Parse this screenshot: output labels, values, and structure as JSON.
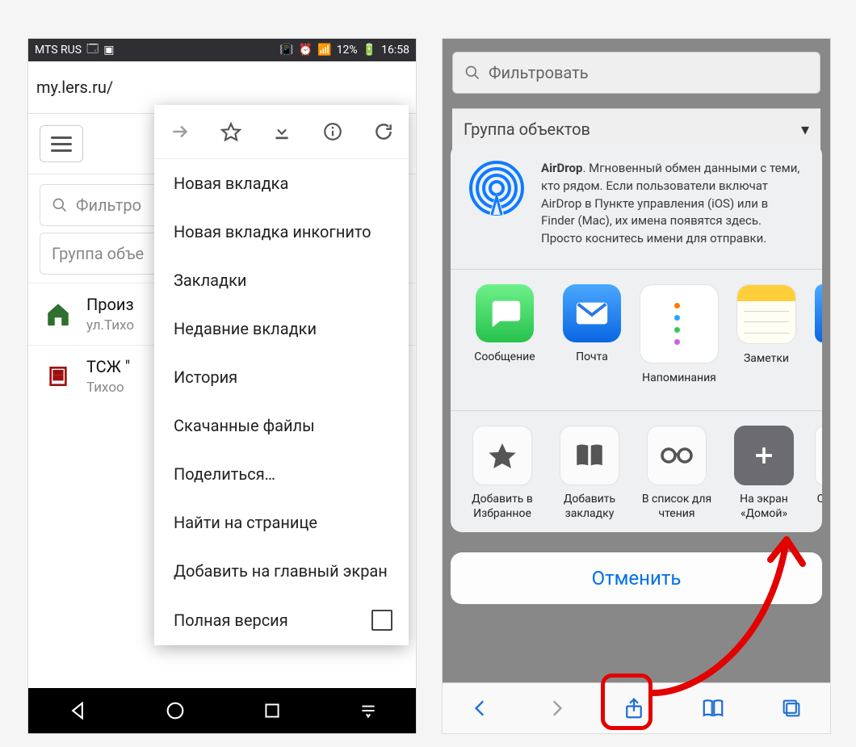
{
  "android": {
    "statusbar": {
      "carrier": "MTS RUS",
      "battery_pct": "12%",
      "clock": "16:58"
    },
    "url": "my.lers.ru/",
    "filter_placeholder": "Фильтро",
    "group_placeholder": "Группа объе",
    "items": [
      {
        "title": "Произ",
        "sub": "ул.Тихо"
      },
      {
        "title": "ТСЖ \"",
        "sub": "Тихоо"
      }
    ],
    "menu": {
      "entries": [
        "Новая вкладка",
        "Новая вкладка инкогнито",
        "Закладки",
        "Недавние вкладки",
        "История",
        "Скачанные файлы",
        "Поделиться…",
        "Найти на странице",
        "Добавить на главный экран"
      ],
      "desktop_site": "Полная версия"
    }
  },
  "ios": {
    "filter_placeholder": "Фильтровать",
    "group_placeholder": "Группа объектов",
    "airdrop": {
      "title": "AirDrop",
      "body": ". Мгновенный обмен данными с теми, кто рядом. Если пользователи включат AirDrop в Пункте управления (iOS) или в Finder (Mac), их имена появятся здесь. Просто коснитесь имени для отправки."
    },
    "share_apps": [
      {
        "name": "Сообщение",
        "bg": "#4cd964"
      },
      {
        "name": "Почта",
        "bg": "linear-gradient(#3fa0ff,#0a66e2)"
      },
      {
        "name": "Напоминания",
        "bg": "#ffffff"
      },
      {
        "name": "Заметки",
        "bg": "#ffffff"
      }
    ],
    "actions": [
      {
        "name": "Добавить в Избранное"
      },
      {
        "name": "Добавить закладку"
      },
      {
        "name": "В список для чтения"
      },
      {
        "name": "На экран «Домой»"
      },
      {
        "name": "Ск"
      }
    ],
    "cancel": "Отменить"
  }
}
